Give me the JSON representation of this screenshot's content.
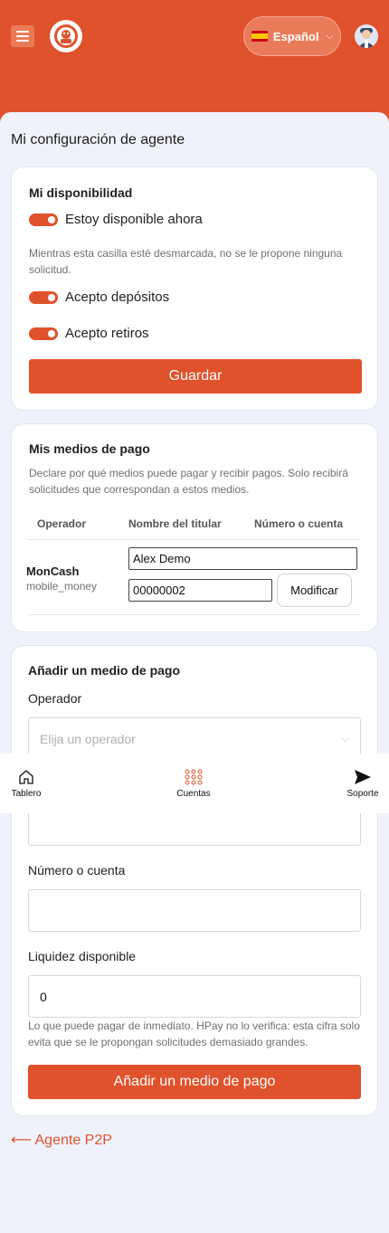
{
  "header": {
    "language_label": "Español",
    "accent_color": "#e0522b"
  },
  "page": {
    "title": "Mi configuración de agente"
  },
  "availability": {
    "title": "Mi disponibilidad",
    "available_label": "Estoy disponible ahora",
    "available_on": true,
    "hint": "Mientras esta casilla esté desmarcada, no se le propone ninguna solicitud.",
    "deposits_label": "Acepto depósitos",
    "deposits_on": true,
    "withdrawals_label": "Acepto retiros",
    "withdrawals_on": true,
    "save_label": "Guardar"
  },
  "payment_methods": {
    "title": "Mis medios de pago",
    "hint": "Declare por qué medios puede pagar y recibir pagos. Solo recibirá solicitudes que correspondan a estos medios.",
    "columns": [
      "Operador",
      "Nombre del titular",
      "Número o cuenta"
    ],
    "rows": [
      {
        "operator": "MonCash",
        "type": "mobile_money",
        "holder": "Alex Demo",
        "account": "00000002",
        "edit_label": "Modificar"
      }
    ]
  },
  "add_method": {
    "title": "Añadir un medio de pago",
    "operator_label": "Operador",
    "operator_placeholder": "Elija un operador",
    "account_label": "Número o cuenta",
    "account_value": "",
    "liquidity_label": "Liquidez disponible",
    "liquidity_value": "0",
    "liquidity_hint": "Lo que puede pagar de inmediato. HPay no lo verifica: esta cifra solo evita que se le propongan solicitudes demasiado grandes.",
    "submit_label": "Añadir un medio de pago"
  },
  "bottom_nav": {
    "items": [
      {
        "label": "Tablero",
        "icon": "home-icon"
      },
      {
        "label": "Cuentas",
        "icon": "grid-icon"
      },
      {
        "label": "Soporte",
        "icon": "send-icon"
      }
    ]
  },
  "footer": {
    "back_label": "⟵ Agente P2P"
  }
}
